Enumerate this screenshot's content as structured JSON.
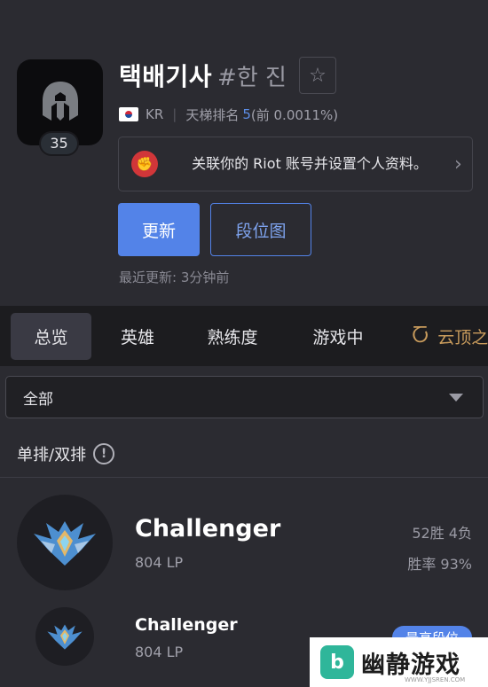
{
  "profile": {
    "name": "택배기사",
    "tag": "#한 진",
    "level": "35",
    "region": "KR",
    "ladder_label": "天梯排名",
    "ladder_rank": "5",
    "ladder_percent": "(前 0.0011%)",
    "avatar_icon": "spartan-helmet-icon"
  },
  "riot_banner": {
    "text": "关联你的 Riot 账号并设置个人资料。"
  },
  "actions": {
    "update_label": "更新",
    "tier_graph_label": "段位图",
    "last_update": "最近更新: 3分钟前"
  },
  "tabs": [
    {
      "label": "总览",
      "active": true
    },
    {
      "label": "英雄"
    },
    {
      "label": "熟练度"
    },
    {
      "label": "游戏中"
    },
    {
      "label": "云顶之"
    }
  ],
  "filter": {
    "selected": "全部"
  },
  "ranked": {
    "section_title": "单排/双排",
    "current": {
      "tier": "Challenger",
      "lp": "804 LP",
      "wins_losses": "52胜 4负",
      "win_rate": "胜率 93%"
    },
    "peak": {
      "tier": "Challenger",
      "lp": "804 LP",
      "badge": "最高段位"
    }
  },
  "watermark": {
    "brand": "幽静游戏",
    "url": "WWW.YJJSREN.COM"
  },
  "colors": {
    "accent": "#5383e8",
    "riot_red": "#d13639",
    "background": "#1c1c1f",
    "panel": "#2b2b31"
  }
}
